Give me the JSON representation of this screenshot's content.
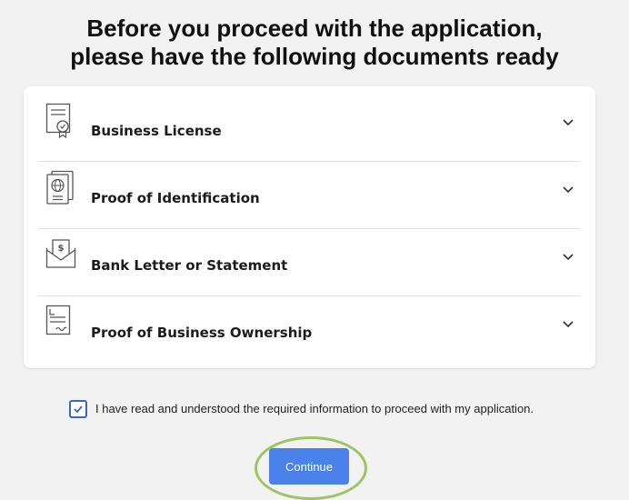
{
  "page": {
    "title_line1": "Before you proceed with the application,",
    "title_line2": "please have the following documents ready"
  },
  "documents": [
    {
      "label": "Business License",
      "icon": "certificate-icon"
    },
    {
      "label": "Proof of Identification",
      "icon": "passport-icon"
    },
    {
      "label": "Bank Letter or Statement",
      "icon": "envelope-dollar-icon"
    },
    {
      "label": "Proof of Business Ownership",
      "icon": "deed-document-icon"
    }
  ],
  "agreement": {
    "checked": true,
    "text": "I have read and understood the required information to proceed with my application."
  },
  "continue_label": "Continue",
  "colors": {
    "accent": "#4a82ea",
    "checkbox": "#3b66c4",
    "highlight": "#9dc467",
    "background": "#f2f2f2"
  }
}
